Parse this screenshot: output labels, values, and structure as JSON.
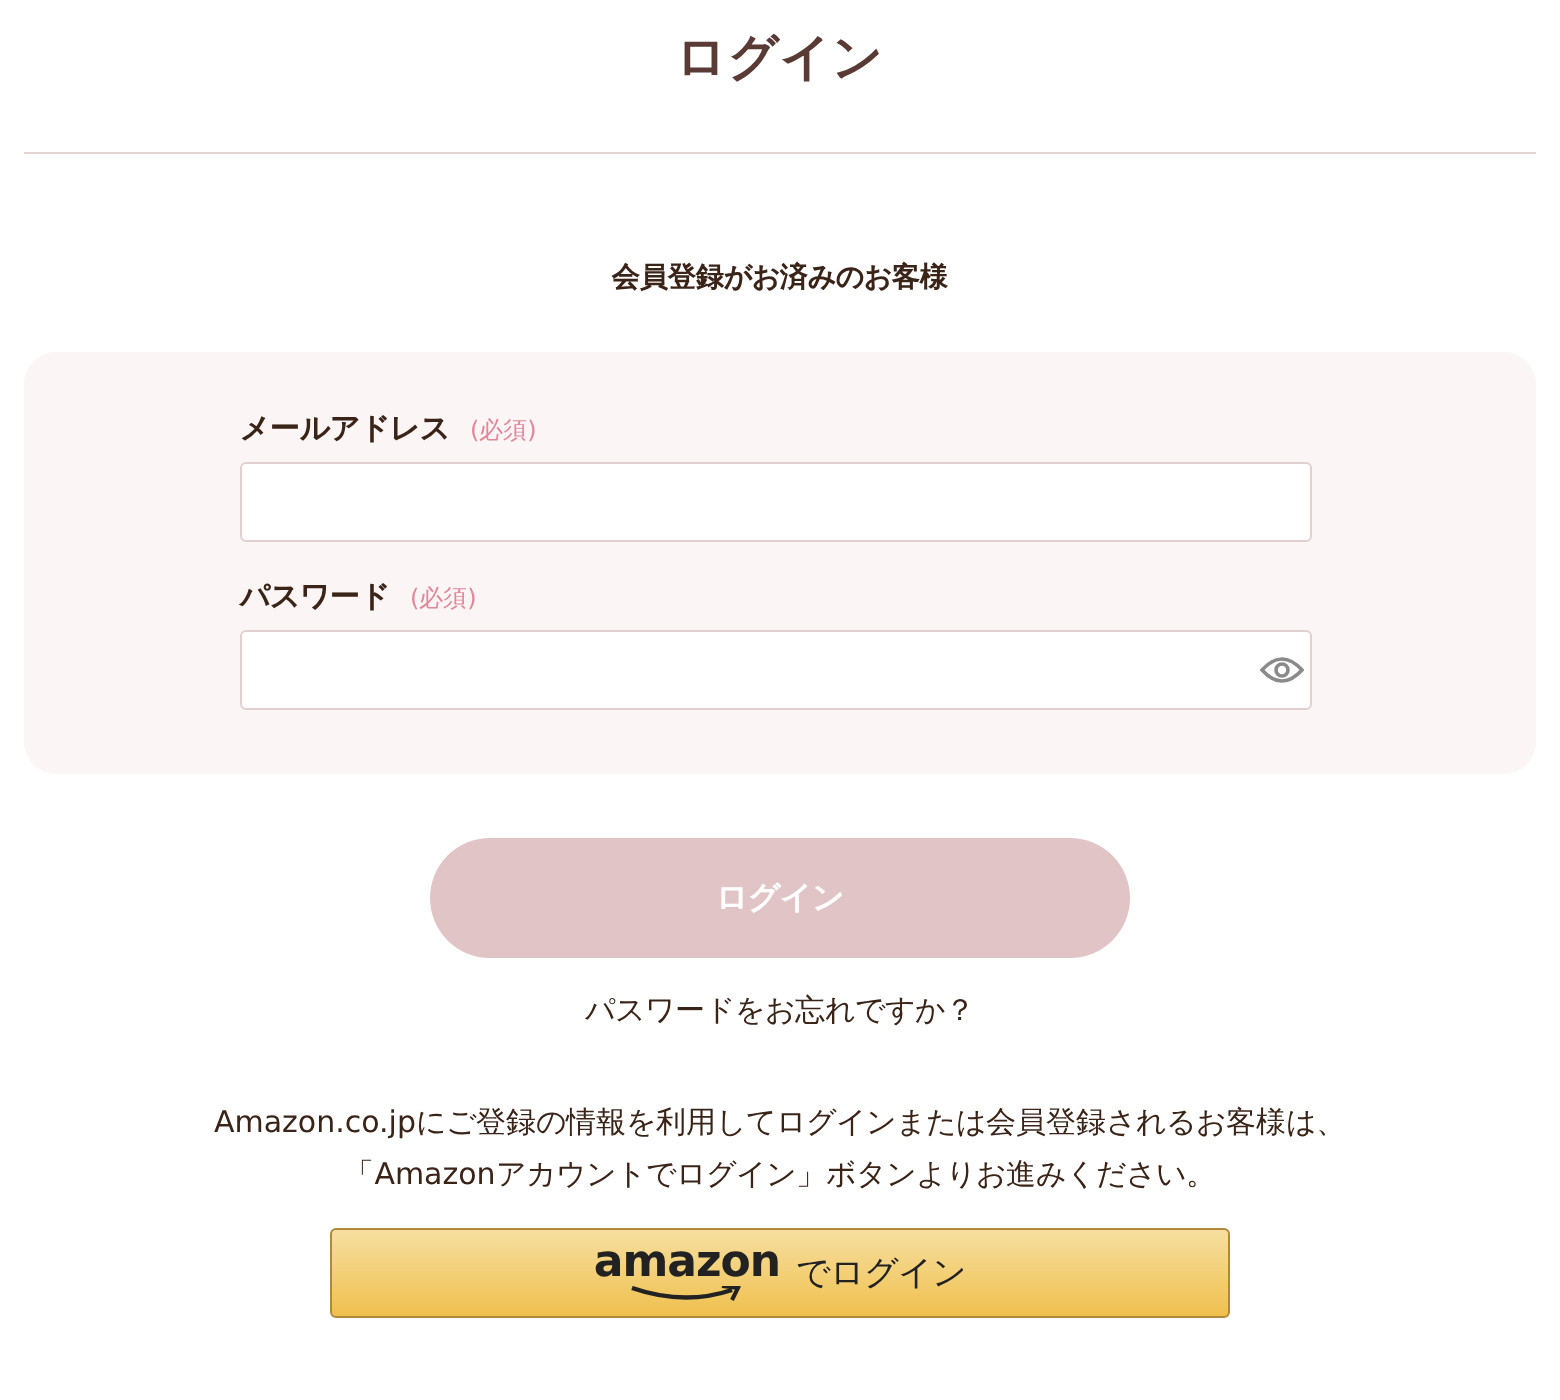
{
  "page_title": "ログイン",
  "section_heading": "会員登録がお済みのお客様",
  "fields": [
    {
      "kind": "email",
      "label": "メールアドレス",
      "required_note": "(必須)"
    },
    {
      "kind": "password",
      "label": "パスワード",
      "required_note": "(必須)"
    }
  ],
  "login_button": {
    "label": "ログイン",
    "disabled": true
  },
  "forgot_link": "パスワードをお忘れですか？",
  "amazon_note": "Amazon.co.jpにご登録の情報を利用してログインまたは会員登録されるお客様は、「Amazonアカウントでログイン」ボタンよりお進みください。",
  "amazon_button": {
    "logo_text": "amazon",
    "label": "でログイン"
  }
}
